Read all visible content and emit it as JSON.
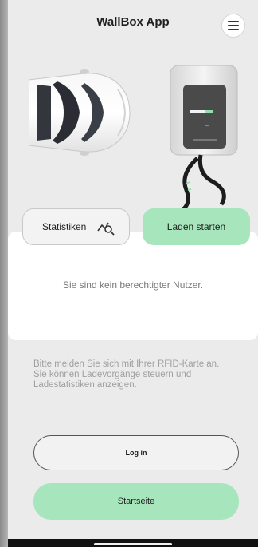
{
  "header": {
    "title": "WallBox App",
    "menu_icon": "hamburger-menu-icon"
  },
  "hero": {
    "car_image": "car-top-view",
    "wallbox_image": "wallbox-charger"
  },
  "actions": {
    "stats_label": "Statistiken",
    "stats_icon": "chart-search-icon",
    "start_label": "Laden starten"
  },
  "message": {
    "text": "Sie sind kein berechtigter Nutzer."
  },
  "info": {
    "text": "Bitte melden Sie sich mit Ihrer RFID-Karte an.\n Sie können Ladevorgänge steuern und Ladestatistiken anzeigen."
  },
  "buttons": {
    "login_label": "Log in",
    "home_label": "Startseite"
  },
  "colors": {
    "accent": "#a7e6bd",
    "background": "#ebebeb",
    "card": "#ffffff"
  }
}
